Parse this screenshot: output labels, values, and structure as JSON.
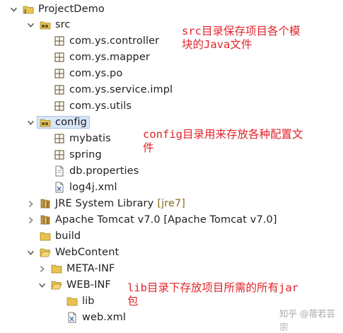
{
  "tree": {
    "project": {
      "label": "ProjectDemo",
      "icon": "project-folder-icon"
    },
    "src": {
      "label": "src",
      "icon": "source-folder-icon",
      "packages": [
        "com.ys.controller",
        "com.ys.mapper",
        "com.ys.po",
        "com.ys.service.impl",
        "com.ys.utils"
      ],
      "package_icon": "package-icon"
    },
    "config": {
      "label": "config",
      "icon": "source-folder-icon",
      "packages": [
        "mybatis",
        "spring"
      ],
      "files": [
        {
          "label": "db.properties",
          "icon": "properties-file-icon"
        },
        {
          "label": "log4j.xml",
          "icon": "xml-file-icon"
        }
      ]
    },
    "jre": {
      "label": "JRE System Library",
      "tag": "[jre7]",
      "icon": "library-icon"
    },
    "tomcat": {
      "label": "Apache Tomcat v7.0 [Apache Tomcat v7.0]",
      "icon": "library-icon"
    },
    "build": {
      "label": "build",
      "icon": "folder-icon"
    },
    "webcontent": {
      "label": "WebContent",
      "icon": "folder-icon",
      "meta_inf": "META-INF",
      "web_inf": "WEB-INF",
      "lib": "lib",
      "web_xml": "web.xml"
    }
  },
  "annotations": {
    "src_note": "src目录保存项目各个模\n块的Java文件",
    "config_note": "config目录用来存放各种配置文\n件",
    "lib_note": "lib目录下存放项目所需的所有jar\n包"
  },
  "watermark": "知乎 @蓿若芸宗",
  "colors": {
    "annotation": "#e0242a",
    "selection": "#d8e6f8",
    "folder": "#e8c34f",
    "package": "#6b5a2a"
  }
}
